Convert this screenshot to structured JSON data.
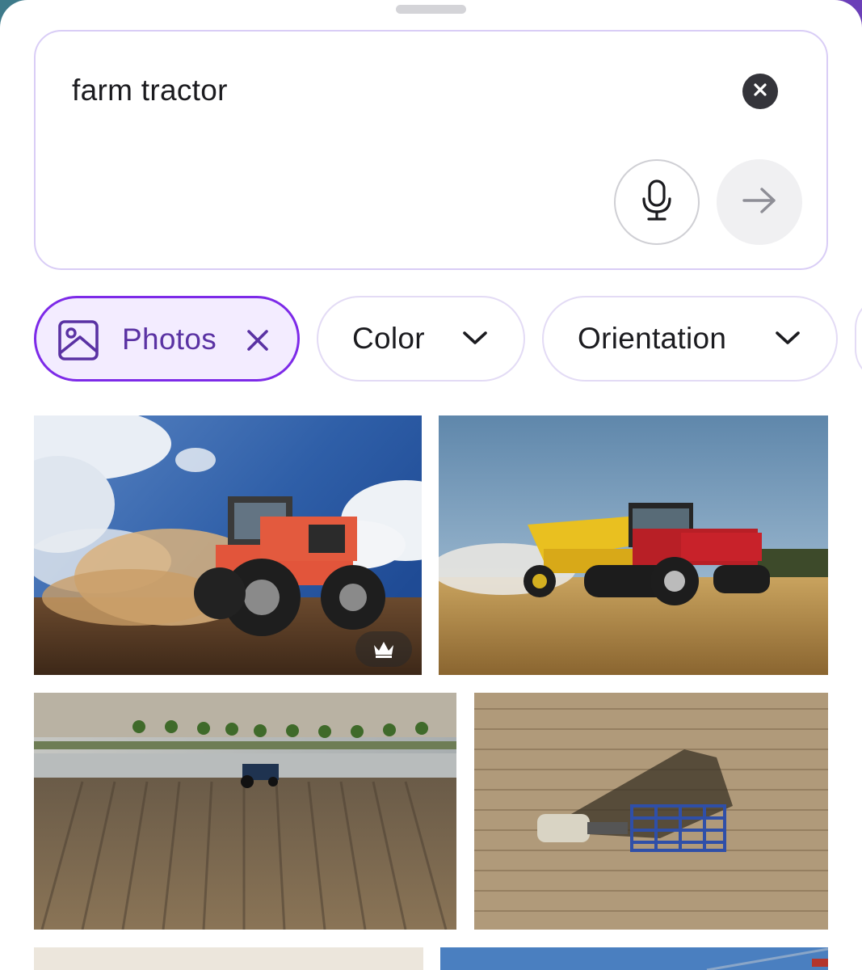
{
  "search": {
    "query": "farm tractor"
  },
  "filters": [
    {
      "label": "Photos",
      "active": true,
      "icon": "image-icon",
      "trailing": "close-icon"
    },
    {
      "label": "Color",
      "active": false,
      "trailing": "chevron-down-icon"
    },
    {
      "label": "Orientation",
      "active": false,
      "trailing": "chevron-down-icon"
    }
  ],
  "results": [
    {
      "subject": "red tractor plowing dusty field under cloudy sky",
      "premium": true
    },
    {
      "subject": "red tracked tractor pulling yellow spreader through stubble",
      "premium": false
    },
    {
      "subject": "aerial view of tractor in flooded rice field",
      "premium": false
    },
    {
      "subject": "overhead view of tractor with blue cultivator",
      "premium": false
    },
    {
      "subject": "partially visible result",
      "premium": false
    },
    {
      "subject": "partially visible result",
      "premium": false
    }
  ],
  "colors": {
    "accent": "#7d2ae8",
    "chip_border": "#e3dbf5",
    "search_border": "#d9cdf6"
  }
}
